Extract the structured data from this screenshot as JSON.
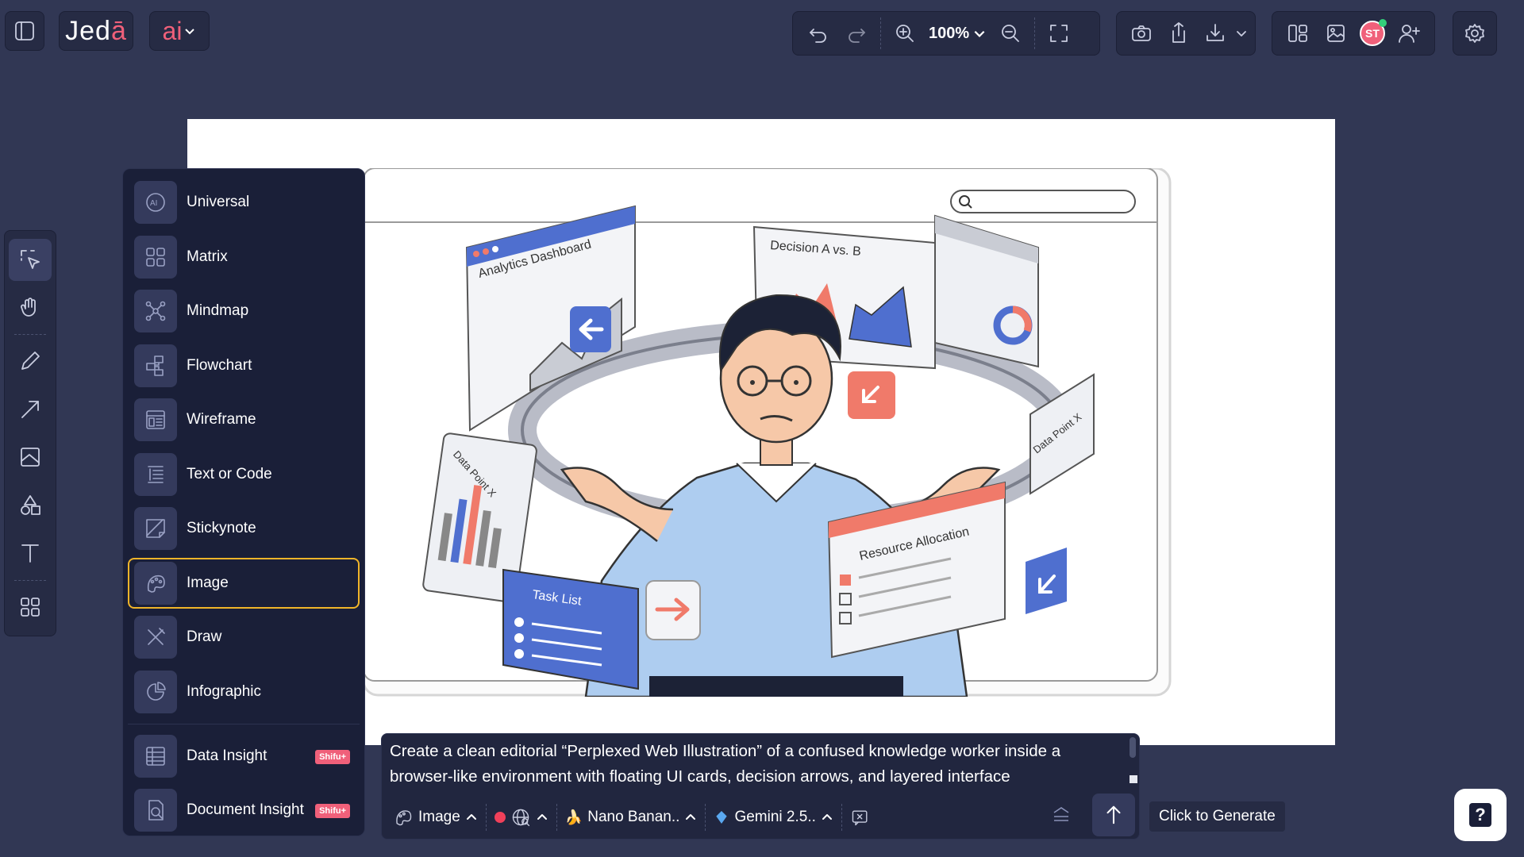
{
  "topbar": {
    "logo_text": "Jed",
    "logo_accent": "ā",
    "ai_label": "ai",
    "zoom_level": "100%",
    "avatar_initials": "ST"
  },
  "menu": {
    "items": [
      {
        "label": "Universal",
        "icon": "ai-chat-icon"
      },
      {
        "label": "Matrix",
        "icon": "grid-icon"
      },
      {
        "label": "Mindmap",
        "icon": "mindmap-icon"
      },
      {
        "label": "Flowchart",
        "icon": "flowchart-icon"
      },
      {
        "label": "Wireframe",
        "icon": "wireframe-icon"
      },
      {
        "label": "Text or Code",
        "icon": "text-code-icon"
      },
      {
        "label": "Stickynote",
        "icon": "stickynote-icon"
      },
      {
        "label": "Image",
        "icon": "image-icon",
        "selected": true
      },
      {
        "label": "Draw",
        "icon": "draw-icon"
      },
      {
        "label": "Infographic",
        "icon": "infographic-icon"
      }
    ],
    "extras": [
      {
        "label": "Data Insight",
        "badge": "Shifu+"
      },
      {
        "label": "Document Insight",
        "badge": "Shifu+"
      }
    ]
  },
  "illustration": {
    "card_analytics": "Analytics Dashboard",
    "card_decision": "Decision A vs. B",
    "card_tasks": "Task List",
    "card_resources": "Resource Allocation",
    "ring_label_left": "Data Point X",
    "ring_label_right": "Data Point X"
  },
  "prompt": {
    "text": "Create a clean editorial “Perplexed Web Illustration” of a confused knowledge worker inside a browser-like environment with floating UI cards, decision arrows, and layered interface",
    "mode_label": "Image",
    "model_label": "Nano Banan..",
    "llm_label": "Gemini 2.5..",
    "generate_tooltip": "Click to Generate"
  },
  "colors": {
    "background": "#313754",
    "panel": "#1a1f38",
    "accent_pink": "#f0607a",
    "selected_border": "#f0b429"
  }
}
